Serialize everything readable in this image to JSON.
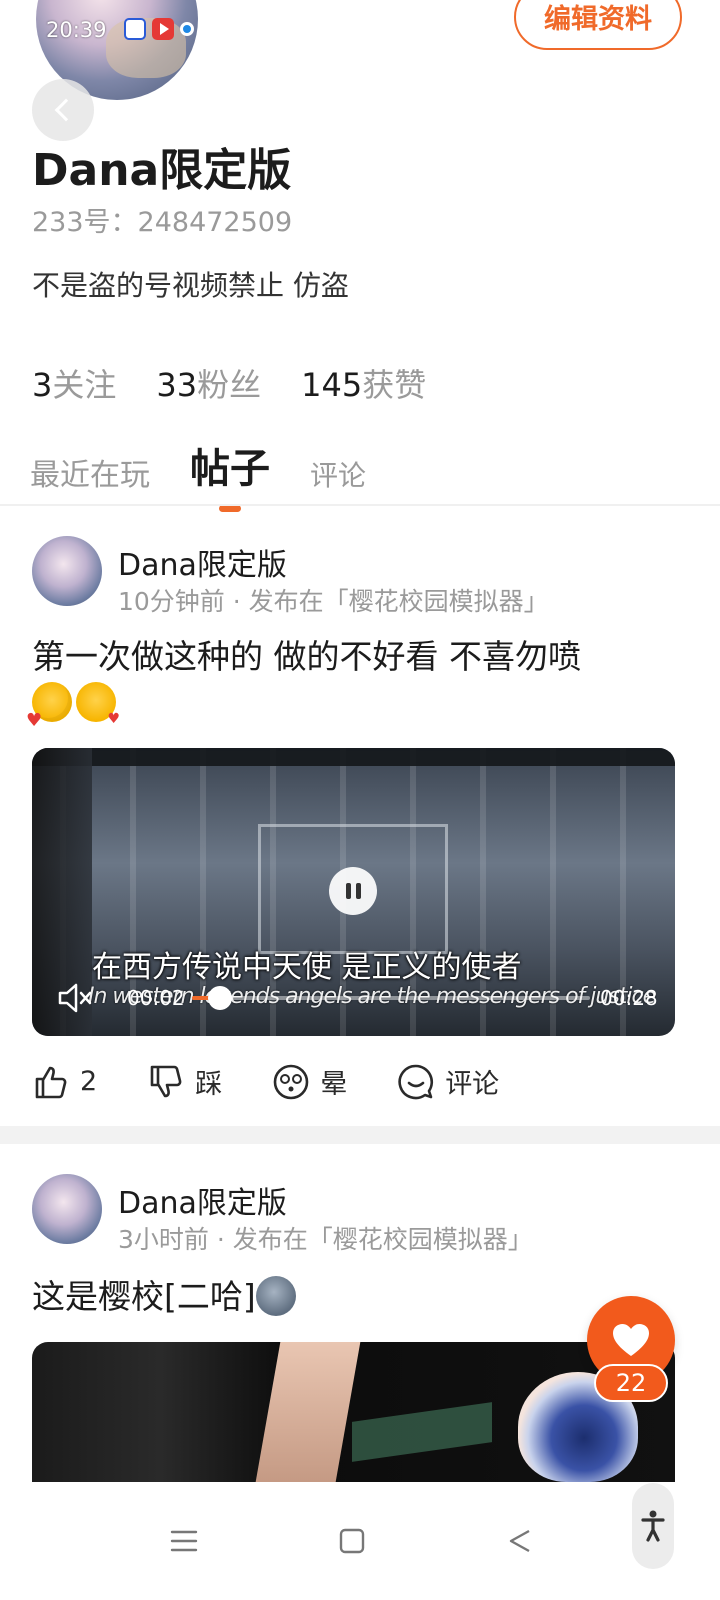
{
  "status_bar": {
    "time": "20:39"
  },
  "header": {
    "edit_label": "编辑资料"
  },
  "profile": {
    "name": "Dana限定版",
    "id_text": "233号：248472509",
    "bio": "不是盗的号视频禁止 仿盗",
    "stats": [
      {
        "num": "3",
        "label": "关注"
      },
      {
        "num": "33",
        "label": "粉丝"
      },
      {
        "num": "145",
        "label": "获赞"
      }
    ]
  },
  "tabs": [
    {
      "label": "最近在玩"
    },
    {
      "label": "帖子"
    },
    {
      "label": "评论"
    }
  ],
  "posts": [
    {
      "author": "Dana限定版",
      "meta": "10分钟前 · 发布在「樱花校园模拟器」",
      "text": "第一次做这种的 做的不好看 不喜勿喷",
      "video": {
        "subtitle": "在西方传说中天使 是正义的使者",
        "subtitle_en": "In western legends angels are the messengers of justice",
        "current_time": "00:02",
        "total_time": "00:28",
        "progress": 0.07
      },
      "actions": {
        "like_count": "2",
        "dislike_label": "踩",
        "dizzy_label": "晕",
        "comment_label": "评论"
      }
    },
    {
      "author": "Dana限定版",
      "meta": "3小时前 · 发布在「樱花校园模拟器」",
      "text": "这是樱校[二哈]"
    }
  ],
  "fab": {
    "count": "22"
  },
  "colors": {
    "accent": "#f06a2a",
    "fab": "#f25a1c"
  }
}
